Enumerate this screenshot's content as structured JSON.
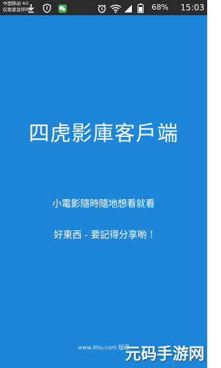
{
  "status_bar": {
    "carrier_line1": "中国移动 4G",
    "carrier_line2": "仅限紧急呼叫",
    "battery_percent": "68%",
    "time": "15:03",
    "left_icons": [
      "download-icon",
      "shield-icon",
      "wechat-icon"
    ],
    "right_icons": [
      "alarm-icon",
      "wifi-icon",
      "signal-icon",
      "battery-icon"
    ]
  },
  "splash": {
    "background_color": "#1d86d8",
    "app_title": "四虎影庫客戶端",
    "slogan_1": "小電影隨時隨地想看就看",
    "slogan_2": "好東西 - 要記得分享喲 !",
    "footer_site": "www.4hu.com  版權"
  },
  "watermark": {
    "text": "元码手游网"
  }
}
